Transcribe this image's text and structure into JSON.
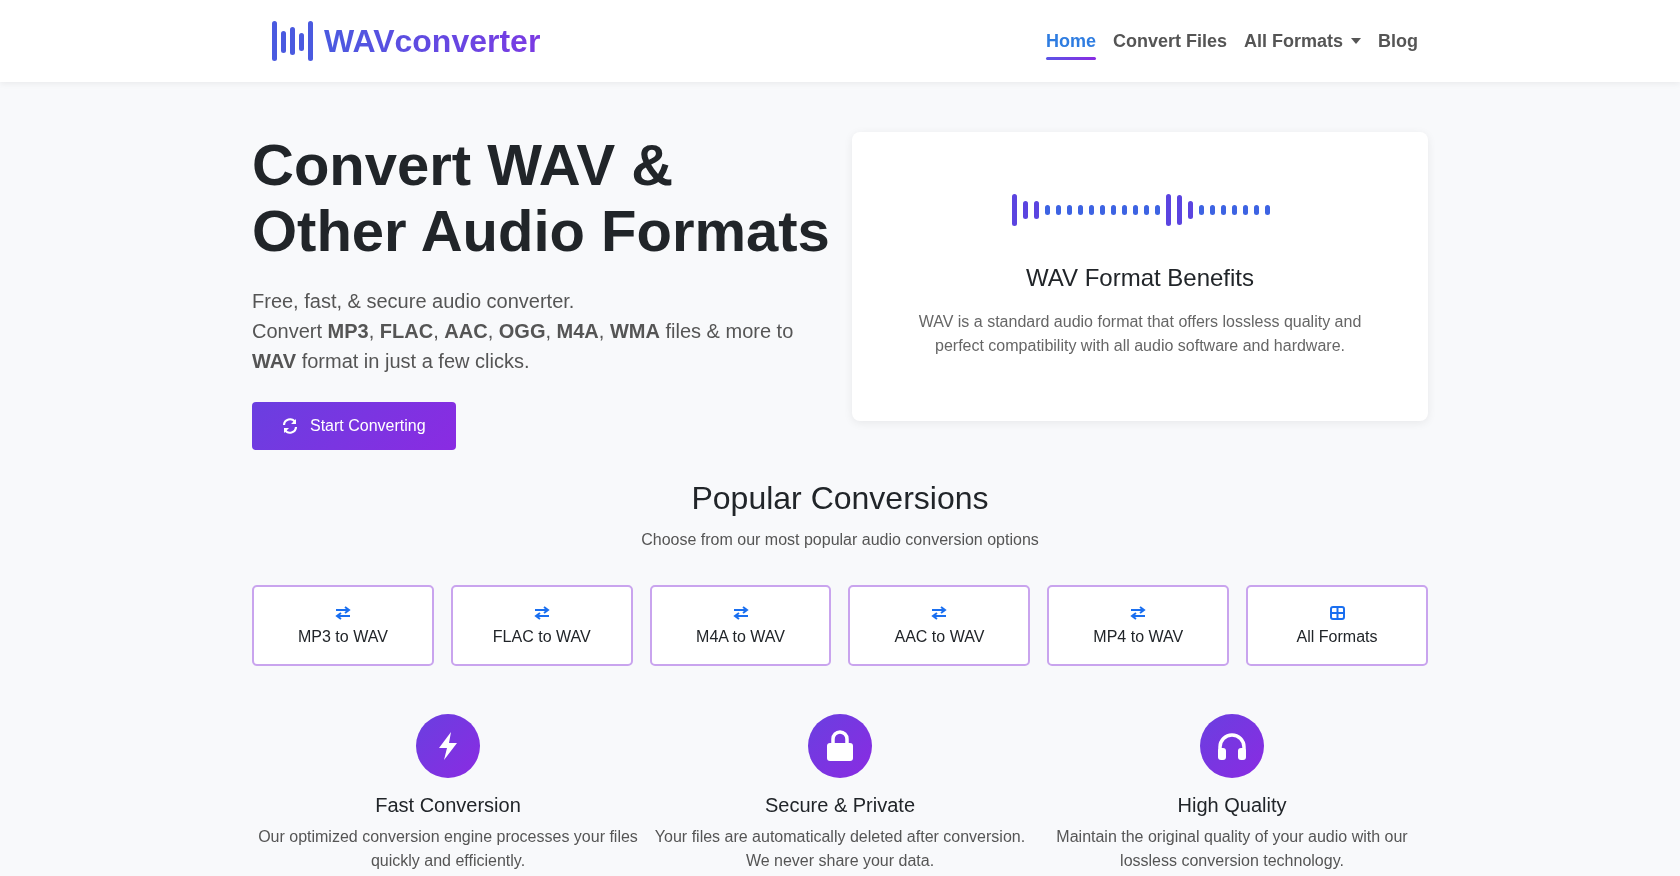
{
  "brand": {
    "name": "WAVconverter"
  },
  "nav": [
    {
      "label": "Home",
      "selected": true,
      "kind": "link"
    },
    {
      "label": "Convert Files",
      "selected": false,
      "kind": "link"
    },
    {
      "label": "All Formats",
      "selected": false,
      "kind": "dropdown"
    },
    {
      "label": "Blog",
      "selected": false,
      "kind": "link"
    }
  ],
  "hero": {
    "title": "Convert WAV & Other Audio Formats",
    "lines": [
      "Free, fast, & secure audio converter.",
      "Convert **MP3**, **FLAC**, **AAC**, **OGG**, **M4A**, **WMA** files & more to **WAV** format in just a few clicks."
    ],
    "button": "Start Converting"
  },
  "card": {
    "title": "WAV Format Benefits",
    "text": "WAV is a standard audio format that offers lossless quality and perfect compatibility with all audio software and hardware."
  },
  "popular": {
    "title": "Popular Conversions",
    "subtitle": "Choose from our most popular audio conversion options",
    "items": [
      {
        "label": "MP3 to WAV",
        "kind": "conversion"
      },
      {
        "label": "FLAC to WAV",
        "kind": "conversion"
      },
      {
        "label": "M4A to WAV",
        "kind": "conversion"
      },
      {
        "label": "AAC to WAV",
        "kind": "conversion"
      },
      {
        "label": "MP4 to WAV",
        "kind": "conversion"
      },
      {
        "label": "All Formats",
        "kind": "grid"
      }
    ]
  },
  "features": [
    {
      "kind": "bolt",
      "title": "Fast Conversion",
      "text": "Our optimized conversion engine processes your files quickly and efficiently."
    },
    {
      "kind": "lock",
      "title": "Secure & Private",
      "text": "Your files are automatically deleted after conversion. We never share your data."
    },
    {
      "kind": "headphones",
      "title": "High Quality",
      "text": "Maintain the original quality of your audio with our lossless conversion technology."
    }
  ]
}
